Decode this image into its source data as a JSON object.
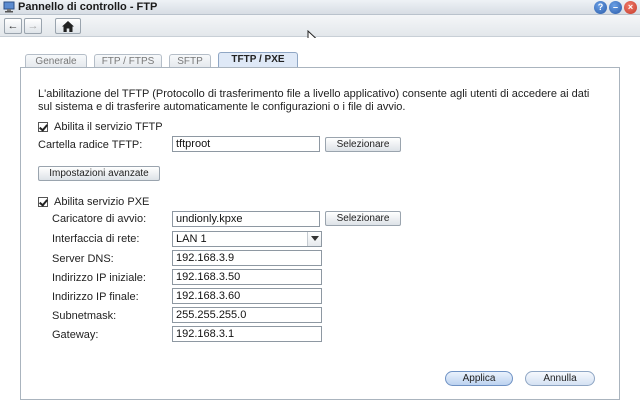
{
  "window": {
    "title": "Pannello di controllo - FTP"
  },
  "toolbar": {
    "back_icon": "back-arrow-icon",
    "forward_icon": "forward-arrow-icon",
    "home_icon": "home-icon"
  },
  "tabs": [
    {
      "label": "Generale",
      "active": false
    },
    {
      "label": "FTP / FTPS",
      "active": false
    },
    {
      "label": "SFTP",
      "active": false
    },
    {
      "label": "TFTP / PXE",
      "active": true
    }
  ],
  "description": "L'abilitazione del TFTP (Protocollo di trasferimento file a livello applicativo) consente agli utenti di accedere ai dati sul sistema e di trasferire automaticamente le configurazioni o i file di avvio.",
  "tftp": {
    "enable_label": "Abilita il servizio TFTP",
    "enabled": true,
    "root_label": "Cartella radice TFTP:",
    "root_value": "tftproot",
    "select_label": "Selezionare",
    "advanced_label": "Impostazioni avanzate"
  },
  "pxe": {
    "enable_label": "Abilita servizio PXE",
    "enabled": true,
    "boot_loader_label": "Caricatore di avvio:",
    "boot_loader_value": "undionly.kpxe",
    "select_label": "Selezionare",
    "interface_label": "Interfaccia di rete:",
    "interface_value": "LAN 1",
    "dns_label": "Server DNS:",
    "dns_value": "192.168.3.9",
    "ip_start_label": "Indirizzo IP iniziale:",
    "ip_start_value": "192.168.3.50",
    "ip_end_label": "Indirizzo IP finale:",
    "ip_end_value": "192.168.3.60",
    "subnet_label": "Subnetmask:",
    "subnet_value": "255.255.255.0",
    "gateway_label": "Gateway:",
    "gateway_value": "192.168.3.1"
  },
  "footer": {
    "apply_label": "Applica",
    "cancel_label": "Annulla"
  },
  "colors": {
    "accent": "#6f92c4",
    "active_tab": "#dfe9f7"
  }
}
